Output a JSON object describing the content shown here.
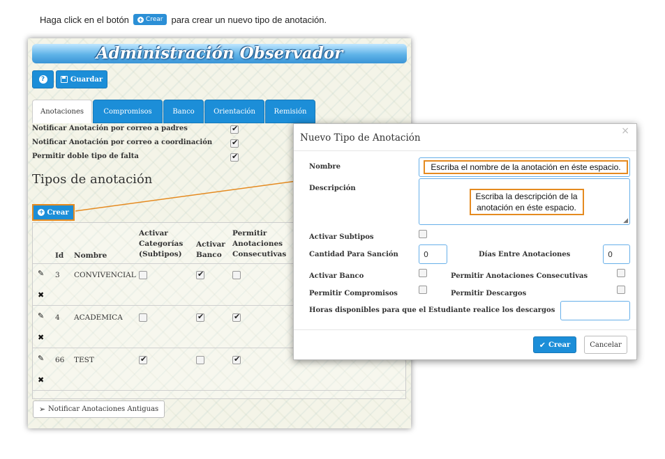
{
  "instruction": {
    "before": "Haga click en el botón",
    "button_label": "Crear",
    "after": "para crear un nuevo tipo de anotación."
  },
  "panel": {
    "title": "Administración Observador",
    "toolbar": {
      "help_icon": "question-circle-icon",
      "save_label": "Guardar"
    },
    "tabs": [
      "Anotaciones",
      "Compromisos",
      "Banco",
      "Orientación",
      "Remisión"
    ],
    "active_tab": "Anotaciones",
    "settings": [
      {
        "label": "Notificar Anotación por correo a padres",
        "checked": true
      },
      {
        "label": "Notificar Anotación por correo a coordinación",
        "checked": true
      },
      {
        "label": "Permitir doble tipo de falta",
        "checked": true
      }
    ],
    "section_title": "Tipos de anotación",
    "create_label": "Crear",
    "table": {
      "headers": {
        "id": "Id",
        "name": "Nombre",
        "categories": [
          "Activar",
          "Categorías",
          "(Subtipos)"
        ],
        "bank": [
          "Activar",
          "Banco"
        ],
        "consecutive": [
          "Permitir",
          "Anotaciones",
          "Consecutivas"
        ]
      },
      "rows": [
        {
          "id": "3",
          "name": "CONVIVENCIAL",
          "categories": false,
          "bank": true,
          "consecutive": false
        },
        {
          "id": "4",
          "name": "ACADEMICA",
          "categories": false,
          "bank": true,
          "consecutive": true
        },
        {
          "id": "66",
          "name": "TEST",
          "categories": true,
          "bank": false,
          "consecutive": true
        }
      ]
    },
    "notify_old_label": "Notificar Anotaciones Antiguas"
  },
  "modal": {
    "title": "Nuevo Tipo de Anotación",
    "close": "×",
    "fields": {
      "nombre": "Nombre",
      "descripcion": "Descripción",
      "activar_subtipos": "Activar Subtipos",
      "cantidad_sancion": "Cantidad Para Sanción",
      "cantidad_sancion_value": "0",
      "dias_entre": "Días Entre Anotaciones",
      "dias_entre_value": "0",
      "activar_banco": "Activar Banco",
      "permitir_consecutivas": "Permitir Anotaciones Consecutivas",
      "permitir_compromisos": "Permitir Compromisos",
      "permitir_descargos": "Permitir Descargos",
      "horas_descargos": "Horas disponibles para que el Estudiante realice los descargos"
    },
    "callouts": {
      "nombre": "Escriba el nombre de la anotación en éste espacio.",
      "descripcion_line1": "Escriba la descripción de la",
      "descripcion_line2": "anotación en éste espacio."
    },
    "buttons": {
      "create": "Crear",
      "cancel": "Cancelar"
    }
  },
  "colors": {
    "primary": "#1c8ed8",
    "callout_border": "#e58a1f"
  }
}
